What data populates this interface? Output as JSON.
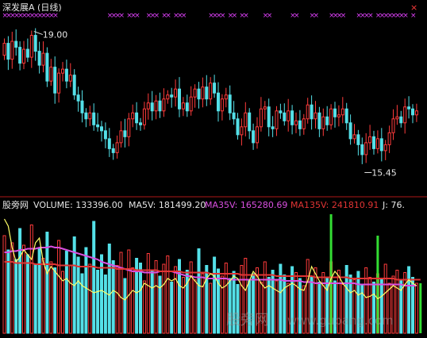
{
  "top": {
    "title": "深发展A (日线)",
    "high_label": "19.00",
    "low_label": "15.45",
    "marker_glyph": "×"
  },
  "bottom": {
    "indicator_name": "股旁网",
    "readouts": [
      {
        "text": "VOLUME: 133396.00",
        "color": "#e6e6e6"
      },
      {
        "text": "MA5V: 181499.20",
        "color": "#e6e6e6"
      },
      {
        "text": "MA35V: 165280.69",
        "color": "#d94fe0"
      },
      {
        "text": "MA135V: 241810.91",
        "color": "#e23434"
      },
      {
        "text": "J: 76.",
        "color": "#e6e6e6"
      }
    ]
  },
  "watermark": {
    "text": "股旁网",
    "url": "www.gupang.com"
  },
  "colors": {
    "up": "#ff3b3b",
    "down": "#54e0e8",
    "marker": "#e040fb",
    "ma35v": "#d94fe0",
    "ma135v": "#e23434",
    "j_line": "#ffff66",
    "signal_bar": "#33dd33",
    "divider": "#b01818"
  },
  "chart_data": [
    {
      "type": "candlestick",
      "title": "深发展A (日线)",
      "price_range": [
        15.0,
        19.35
      ],
      "extremes": {
        "high": 19.0,
        "low": 15.45
      },
      "open": [
        18.4,
        18.7,
        18.3,
        18.75,
        18.6,
        18.2,
        18.55,
        18.35,
        18.9,
        18.5,
        18.15,
        18.45,
        17.75,
        18.1,
        17.45,
        17.95,
        18.05,
        17.75,
        17.9,
        17.4,
        17.25,
        16.95,
        16.8,
        16.95,
        16.65,
        16.6,
        16.5,
        16.3,
        16.05,
        15.95,
        16.2,
        16.5,
        16.35,
        16.8,
        16.95,
        16.7,
        16.65,
        17.05,
        17.2,
        17.0,
        17.25,
        17.0,
        17.3,
        17.4,
        17.35,
        17.55,
        17.05,
        17.2,
        17.0,
        17.35,
        17.55,
        17.3,
        17.6,
        17.3,
        17.7,
        17.45,
        17.0,
        17.3,
        17.4,
        16.95,
        16.8,
        16.4,
        16.6,
        16.95,
        16.5,
        16.2,
        16.6,
        17.05,
        17.1,
        16.6,
        16.55,
        17.0,
        16.95,
        16.75,
        17.0,
        16.65,
        16.75,
        16.55,
        16.8,
        17.15,
        16.8,
        16.95,
        16.55,
        16.85,
        16.65,
        17.05,
        16.85,
        16.9,
        17.05,
        16.7,
        16.3,
        16.4,
        16.15,
        15.9,
        16.2,
        16.35,
        16.05,
        16.3,
        16.0,
        16.15,
        16.45,
        16.8,
        16.85,
        16.7,
        17.1,
        17.05,
        16.9
      ],
      "close": [
        18.7,
        18.3,
        18.75,
        18.6,
        18.2,
        18.55,
        18.35,
        18.9,
        18.5,
        18.15,
        18.45,
        17.75,
        18.1,
        17.45,
        17.95,
        18.05,
        17.75,
        17.9,
        17.4,
        17.25,
        16.95,
        16.8,
        16.95,
        16.65,
        16.6,
        16.5,
        16.3,
        16.05,
        15.95,
        16.2,
        16.5,
        16.35,
        16.8,
        16.95,
        16.7,
        16.65,
        17.05,
        17.2,
        17.0,
        17.25,
        17.0,
        17.3,
        17.4,
        17.35,
        17.55,
        17.05,
        17.2,
        17.0,
        17.35,
        17.55,
        17.3,
        17.6,
        17.3,
        17.7,
        17.45,
        17.0,
        17.3,
        17.4,
        16.95,
        16.8,
        16.4,
        16.6,
        16.95,
        16.5,
        16.2,
        16.6,
        17.05,
        17.1,
        16.6,
        16.55,
        17.0,
        16.95,
        16.75,
        17.0,
        16.65,
        16.75,
        16.55,
        16.8,
        17.15,
        16.8,
        16.95,
        16.55,
        16.85,
        16.65,
        17.05,
        16.85,
        16.9,
        17.05,
        16.7,
        16.3,
        16.4,
        16.15,
        15.9,
        16.2,
        16.35,
        16.05,
        16.3,
        16.0,
        16.15,
        16.45,
        16.8,
        16.85,
        16.7,
        17.1,
        17.05,
        16.9,
        17.0
      ],
      "markers_top": [
        0,
        1,
        2,
        3,
        4,
        5,
        6,
        7,
        8,
        9,
        10,
        11,
        12,
        13,
        27,
        28,
        29,
        30,
        32,
        33,
        34,
        37,
        38,
        39,
        41,
        42,
        44,
        45,
        46,
        53,
        54,
        55,
        56,
        58,
        59,
        61,
        62,
        67,
        68,
        74,
        75,
        79,
        80,
        84,
        85,
        86,
        87,
        91,
        92,
        93,
        94,
        96,
        97,
        98,
        99,
        100,
        101,
        102,
        103,
        105
      ]
    },
    {
      "type": "bar",
      "title": "VOLUME",
      "ylim": [
        0,
        100
      ],
      "values": [
        82,
        70,
        76,
        62,
        88,
        74,
        66,
        91,
        58,
        72,
        63,
        85,
        60,
        55,
        78,
        52,
        69,
        57,
        81,
        64,
        50,
        72,
        58,
        94,
        53,
        66,
        49,
        75,
        61,
        57,
        68,
        46,
        70,
        55,
        63,
        59,
        44,
        67,
        52,
        61,
        48,
        58,
        65,
        43,
        56,
        62,
        47,
        53,
        60,
        45,
        71,
        50,
        57,
        42,
        64,
        54,
        48,
        59,
        46,
        52,
        41,
        57,
        63,
        45,
        50,
        55,
        43,
        60,
        47,
        53,
        44,
        58,
        49,
        42,
        56,
        51,
        46,
        40,
        62,
        48,
        55,
        43,
        51,
        47,
        60,
        44,
        53,
        41,
        57,
        49,
        45,
        52,
        40,
        55,
        47,
        43,
        50,
        46,
        58,
        42,
        48,
        53,
        44,
        51,
        56,
        47,
        42
      ],
      "signal_bars": [
        {
          "index": 84,
          "value": 100
        },
        {
          "index": 96,
          "value": 82
        },
        {
          "index": 107,
          "value": 42
        }
      ],
      "series": [
        {
          "name": "MA35V",
          "values": [
            68,
            68,
            69,
            69,
            70,
            70,
            71,
            71,
            71,
            72,
            72,
            72,
            73,
            72,
            72,
            71,
            70,
            69,
            68,
            67,
            66,
            65,
            64,
            63,
            62,
            60,
            59,
            58,
            57,
            56,
            55,
            54,
            53,
            52,
            52,
            52,
            51,
            51,
            51,
            51,
            52,
            52,
            52,
            52,
            51,
            50,
            49,
            48,
            48,
            47,
            47,
            47,
            46,
            46,
            46,
            46,
            46,
            46,
            45,
            45,
            45,
            45,
            45,
            45,
            45,
            45,
            45,
            45,
            45,
            45,
            45,
            45,
            44,
            44,
            44,
            44,
            44,
            43,
            43,
            43,
            42,
            42,
            42,
            42,
            42,
            42,
            42,
            42,
            42,
            42,
            42,
            41,
            41,
            41,
            41,
            41,
            41,
            41,
            41,
            41,
            41,
            41,
            41,
            40,
            40,
            40,
            40
          ]
        },
        {
          "name": "MA135V",
          "values": [
            60,
            60,
            60,
            59,
            59,
            59,
            59,
            59,
            58,
            58,
            58,
            58,
            58,
            58,
            57,
            57,
            57,
            57,
            57,
            56,
            56,
            56,
            56,
            56,
            55,
            55,
            55,
            55,
            55,
            54,
            54,
            54,
            54,
            54,
            53,
            53,
            53,
            53,
            53,
            53,
            52,
            52,
            52,
            52,
            52,
            52,
            51,
            51,
            51,
            51,
            51,
            51,
            51,
            50,
            50,
            50,
            50,
            50,
            50,
            50,
            50,
            49,
            49,
            49,
            49,
            49,
            49,
            49,
            49,
            49,
            48,
            48,
            48,
            48,
            48,
            48,
            48,
            48,
            48,
            48,
            47,
            47,
            47,
            47,
            47,
            47,
            47,
            47,
            47,
            46,
            46,
            46,
            46,
            46,
            46,
            46,
            46,
            46,
            46,
            46,
            46,
            45,
            45,
            45,
            45,
            45,
            45,
            45
          ]
        },
        {
          "name": "J",
          "values": [
            96,
            90,
            72,
            60,
            64,
            70,
            66,
            62,
            76,
            80,
            60,
            50,
            56,
            52,
            48,
            44,
            46,
            42,
            40,
            44,
            40,
            38,
            36,
            34,
            35,
            36,
            34,
            32,
            36,
            34,
            30,
            28,
            32,
            36,
            34,
            36,
            42,
            40,
            38,
            40,
            38,
            41,
            46,
            44,
            46,
            40,
            38,
            42,
            48,
            44,
            40,
            39,
            46,
            50,
            48,
            42,
            38,
            40,
            44,
            48,
            46,
            40,
            36,
            44,
            52,
            48,
            42,
            38,
            40,
            38,
            36,
            34,
            38,
            40,
            42,
            40,
            37,
            36,
            44,
            56,
            50,
            44,
            40,
            36,
            46,
            52,
            48,
            42,
            38,
            34,
            36,
            32,
            34,
            30,
            31,
            33,
            29,
            31,
            34,
            37,
            40,
            38,
            36,
            41,
            45,
            42,
            40
          ]
        }
      ]
    }
  ]
}
